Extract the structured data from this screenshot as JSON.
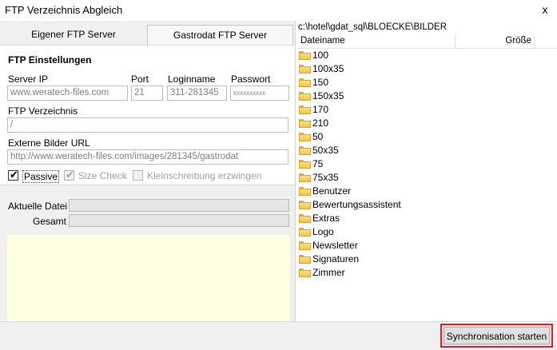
{
  "window": {
    "title": "FTP Verzeichnis Abgleich",
    "close_glyph": "x"
  },
  "tabs": [
    {
      "label": "Eigener FTP Server"
    },
    {
      "label": "Gastrodat FTP Server"
    }
  ],
  "ftp": {
    "heading": "FTP Einstellungen",
    "server_ip_label": "Server IP",
    "server_ip_value": "www.weratech-files.com",
    "port_label": "Port",
    "port_value": "21",
    "login_label": "Loginname",
    "login_value": "311-281345",
    "password_label": "Passwort",
    "password_value": "xxxxxxxxxx",
    "dir_label": "FTP Verzeichnis",
    "dir_value": "/",
    "url_label": "Externe Bilder URL",
    "url_value": "http://www.weratech-files.com/images/281345/gastrodat",
    "passive_label": "Passive",
    "passive_checked": true,
    "sizecheck_label": "Size Check",
    "sizecheck_checked": true,
    "lowercase_label": "Kleinschreibung erzwingen",
    "lowercase_checked": false
  },
  "progress": {
    "current_label": "Aktuelle Datei",
    "current_value": 0,
    "total_label": "Gesamt",
    "total_value": 0
  },
  "explorer": {
    "path": "c:\\hotel\\gdat_sql\\BLOECKE\\BILDER",
    "col_name": "Dateiname",
    "col_size": "Größe",
    "items": [
      "100",
      "100x35",
      "150",
      "150x35",
      "170",
      "210",
      "50",
      "50x35",
      "75",
      "75x35",
      "Benutzer",
      "Bewertungsassistent",
      "Extras",
      "Logo",
      "Newsletter",
      "Signaturen",
      "Zimmer"
    ]
  },
  "sync_button": {
    "label": "Synchronisation starten"
  },
  "icons": {
    "folder": "folder-icon",
    "check": "check-icon",
    "close": "close-icon"
  }
}
